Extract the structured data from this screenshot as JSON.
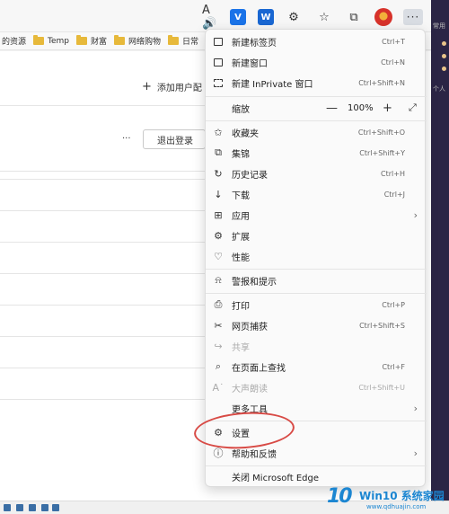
{
  "toolbar": {
    "icons": [
      "read-aloud-icon",
      "extension-icon",
      "extension-icon",
      "extensions-puzzle-icon",
      "favorites-star-icon",
      "collections-icon",
      "profile-avatar",
      "more-menu-icon"
    ],
    "ext1": "V",
    "ext2": "W",
    "more": "···"
  },
  "favorites_bar": {
    "items": [
      {
        "label": "的资源",
        "icon": ""
      },
      {
        "label": "Temp",
        "icon": "folder-icon"
      },
      {
        "label": "财富",
        "icon": "folder-icon"
      },
      {
        "label": "网络购物",
        "icon": "folder-icon"
      },
      {
        "label": "日常",
        "icon": "folder-icon"
      }
    ]
  },
  "page": {
    "add_user": "添加用户配",
    "add_user_icon": "+",
    "dots": "···",
    "logout": "退出登录"
  },
  "side_panel": {
    "label1": "常用",
    "label2": "个人"
  },
  "menu": {
    "new_tab": {
      "label": "新建标签页",
      "shortcut": "Ctrl+T"
    },
    "new_window": {
      "label": "新建窗口",
      "shortcut": "Ctrl+N"
    },
    "new_inprivate": {
      "label": "新建 InPrivate 窗口",
      "shortcut": "Ctrl+Shift+N"
    },
    "zoom": {
      "label": "缩放",
      "value": "100%",
      "minus": "—",
      "plus": "+",
      "fullscreen": "⤢"
    },
    "favorites": {
      "label": "收藏夹",
      "shortcut": "Ctrl+Shift+O"
    },
    "collections": {
      "label": "集锦",
      "shortcut": "Ctrl+Shift+Y"
    },
    "history": {
      "label": "历史记录",
      "shortcut": "Ctrl+H"
    },
    "downloads": {
      "label": "下载",
      "shortcut": "Ctrl+J"
    },
    "apps": {
      "label": "应用"
    },
    "extensions": {
      "label": "扩展"
    },
    "performance": {
      "label": "性能"
    },
    "alerts": {
      "label": "警报和提示"
    },
    "print": {
      "label": "打印",
      "shortcut": "Ctrl+P"
    },
    "web_capture": {
      "label": "网页捕获",
      "shortcut": "Ctrl+Shift+S"
    },
    "share": {
      "label": "共享"
    },
    "find": {
      "label": "在页面上查找",
      "shortcut": "Ctrl+F"
    },
    "read_aloud": {
      "label": "大声朗读",
      "shortcut": "Ctrl+Shift+U"
    },
    "more_tools": {
      "label": "更多工具"
    },
    "settings": {
      "label": "设置"
    },
    "help": {
      "label": "帮助和反馈"
    },
    "close": {
      "label": "关闭 Microsoft Edge"
    }
  },
  "watermark": {
    "num": "10",
    "title": "Win10 系统家园",
    "sub": "www.qdhuajin.com"
  },
  "colors": {
    "accent": "#1a73e8",
    "highlight_circle": "#d84a45",
    "watermark": "#1c86d1"
  }
}
